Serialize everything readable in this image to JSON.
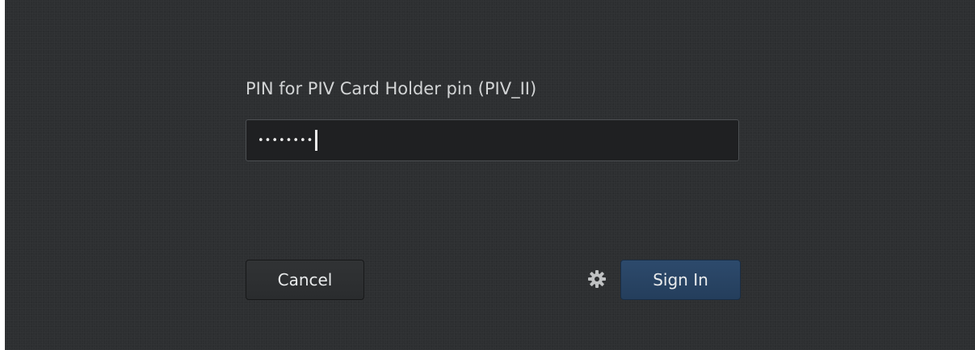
{
  "dialog": {
    "prompt": "PIN for PIV Card Holder pin (PIV_II)",
    "pin_field": {
      "value": "••••••••"
    },
    "cancel_label": "Cancel",
    "sign_in_label": "Sign In",
    "options_icon": "gear-icon"
  },
  "colors": {
    "background": "#2d2f31",
    "field_background": "#1f2022",
    "primary_button": "#2d4a6c",
    "text": "#d2d4d5"
  }
}
